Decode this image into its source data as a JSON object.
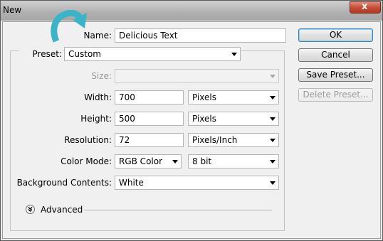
{
  "window": {
    "title": "New",
    "close_glyph": "x"
  },
  "fields": {
    "name": {
      "label": "Name:",
      "value": "Delicious Text"
    },
    "preset": {
      "label": "Preset:",
      "value": "Custom"
    },
    "size": {
      "label": "Size:",
      "value": ""
    },
    "width": {
      "label": "Width:",
      "value": "700",
      "unit": "Pixels"
    },
    "height": {
      "label": "Height:",
      "value": "500",
      "unit": "Pixels"
    },
    "resolution": {
      "label": "Resolution:",
      "value": "72",
      "unit": "Pixels/Inch"
    },
    "color_mode": {
      "label": "Color Mode:",
      "value": "RGB Color",
      "depth": "8 bit"
    },
    "background": {
      "label": "Background Contents:",
      "value": "White"
    }
  },
  "advanced": {
    "label": "Advanced"
  },
  "buttons": {
    "ok": "OK",
    "cancel": "Cancel",
    "save_preset": "Save Preset...",
    "delete_preset": "Delete Preset..."
  },
  "colors": {
    "accent_arrow": "#3cb4c8",
    "default_button_border": "#3c7fb1"
  }
}
